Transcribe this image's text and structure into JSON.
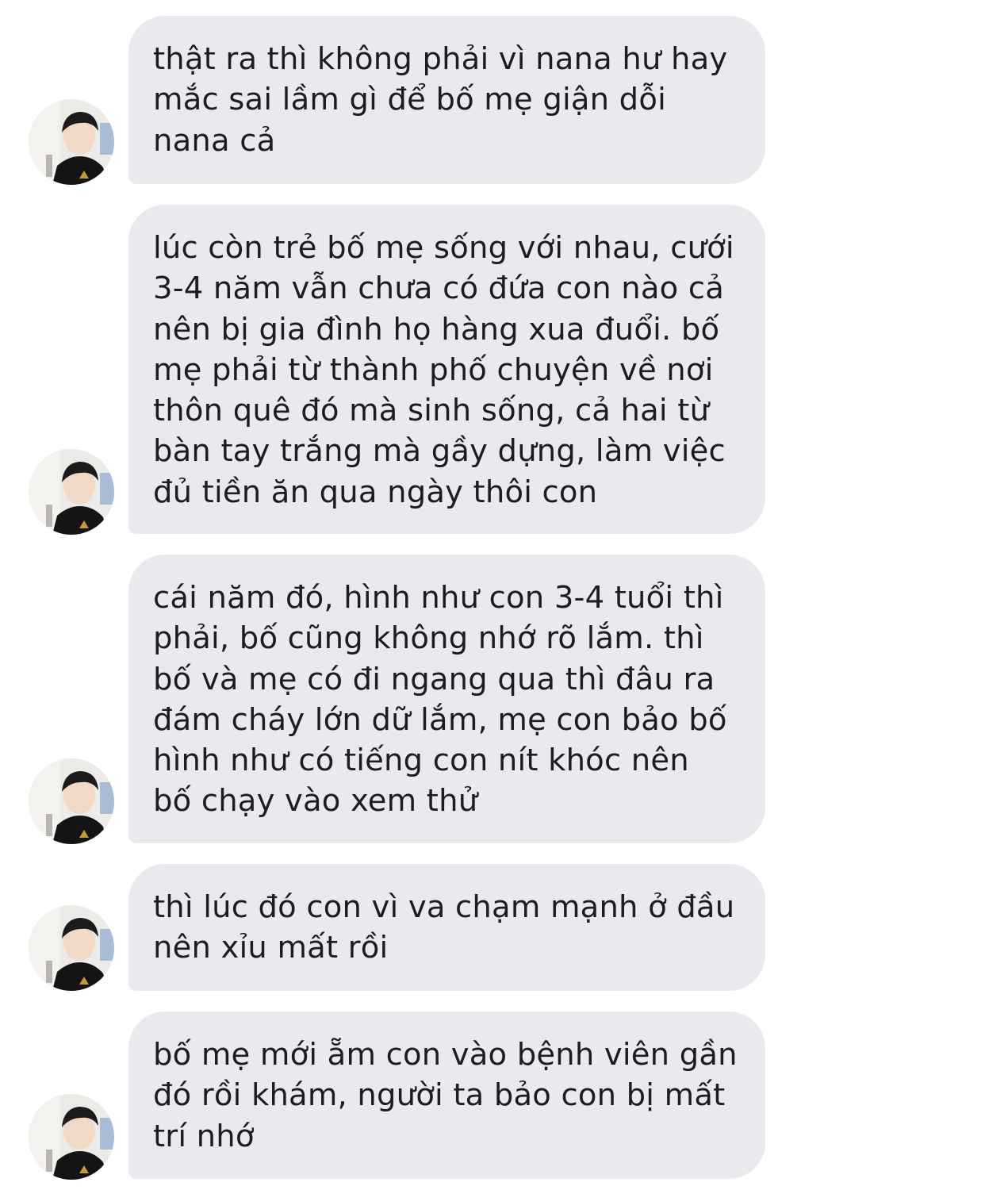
{
  "chat": {
    "bubble_color": "#e9eaee",
    "text_color": "#1d1d1f",
    "avatar_icon": "user-avatar-photo",
    "messages": [
      {
        "text": "thật ra thì không phải vì nana hư hay\nmắc sai lầm gì để bố mẹ giận dỗi\nnana cả"
      },
      {
        "text": "lúc còn trẻ bố mẹ sống với nhau, cưới\n3-4 năm vẫn chưa có đứa con nào cả\nnên bị gia đình họ hàng xua đuổi. bố\nmẹ phải từ thành phố chuyện về nơi\nthôn quê đó mà sinh sống, cả hai từ\nbàn tay trắng mà gầy dựng, làm việc\nđủ tiền ăn qua ngày thôi con"
      },
      {
        "text": "cái năm đó, hình như con 3-4 tuổi thì\nphải, bố cũng không nhớ rõ lắm. thì\nbố và mẹ có đi ngang qua thì đâu ra\nđám cháy lớn dữ lắm, mẹ con bảo bố\nhình như có tiếng con nít khóc nên\nbố chạy vào xem thử"
      },
      {
        "text": "thì lúc đó con vì va chạm mạnh ở đầu\nnên xỉu mất rồi"
      },
      {
        "text": "bố mẹ mới ẵm con vào bệnh viên gần\nđó rồi khám, người ta bảo con bị mất\ntrí nhớ"
      }
    ]
  }
}
